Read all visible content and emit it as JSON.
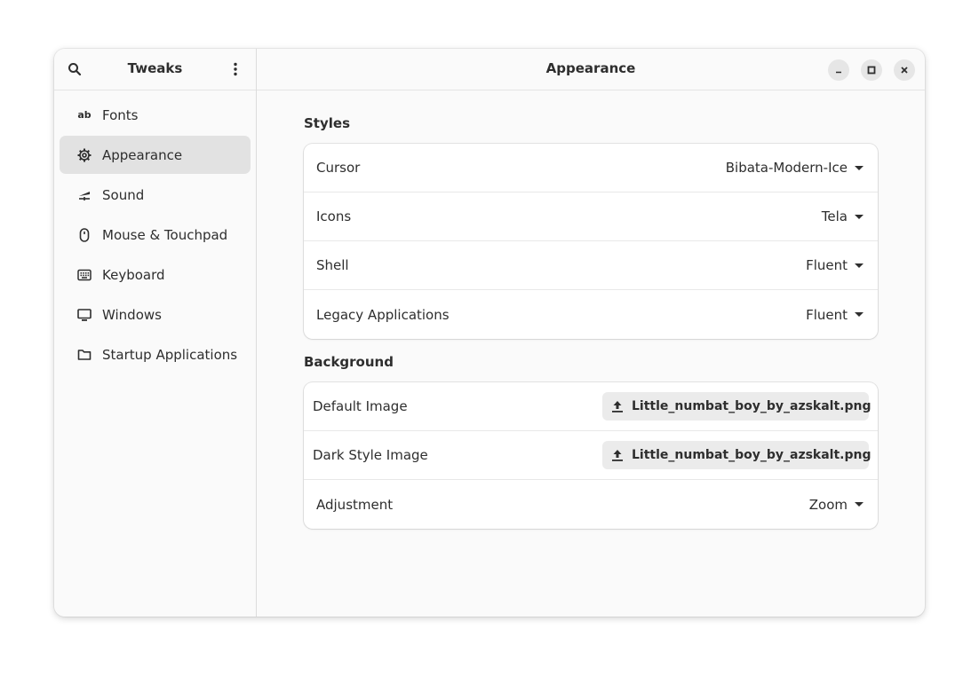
{
  "sidebar": {
    "title": "Tweaks",
    "items": [
      {
        "label": "Fonts",
        "icon": "fonts-icon"
      },
      {
        "label": "Appearance",
        "icon": "gear-icon"
      },
      {
        "label": "Sound",
        "icon": "sound-icon"
      },
      {
        "label": "Mouse & Touchpad",
        "icon": "mouse-icon"
      },
      {
        "label": "Keyboard",
        "icon": "keyboard-icon"
      },
      {
        "label": "Windows",
        "icon": "monitor-icon"
      },
      {
        "label": "Startup Applications",
        "icon": "folder-icon"
      }
    ],
    "active_index": 1,
    "fonts_glyph": "ab"
  },
  "main": {
    "title": "Appearance",
    "styles": {
      "title": "Styles",
      "rows": [
        {
          "label": "Cursor",
          "value": "Bibata-Modern-Ice"
        },
        {
          "label": "Icons",
          "value": "Tela"
        },
        {
          "label": "Shell",
          "value": "Fluent"
        },
        {
          "label": "Legacy Applications",
          "value": "Fluent"
        }
      ]
    },
    "background": {
      "title": "Background",
      "default_image": {
        "label": "Default Image",
        "file": "Little_numbat_boy_by_azskalt.png"
      },
      "dark_image": {
        "label": "Dark Style Image",
        "file": "Little_numbat_boy_by_azskalt.png"
      },
      "adjustment": {
        "label": "Adjustment",
        "value": "Zoom"
      }
    }
  },
  "colors": {
    "window_bg": "#fafafa",
    "active_item": "#e2e2e2",
    "card_bg": "#ffffff",
    "button_bg": "#ebebeb"
  }
}
